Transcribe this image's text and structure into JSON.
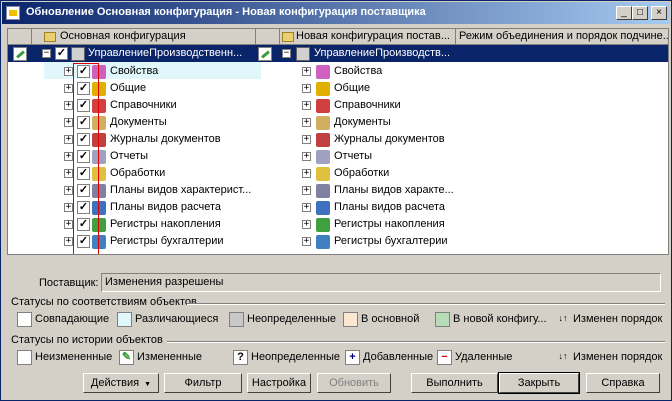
{
  "window": {
    "title": "Обновление Основная конфигурация - Новая конфигурация поставщика",
    "controls": [
      "_",
      "□",
      "×"
    ]
  },
  "grid": {
    "columns": {
      "main": "Основная конфигурация",
      "vendor": "Новая конфигурация постав...",
      "mode": "Режим объединения и порядок подчине..."
    },
    "root": {
      "main": "УправлениеПроизводственн...",
      "vendor": "УправлениеПроизводств..."
    },
    "rows": [
      {
        "main": "Свойства",
        "vendor": "Свойства",
        "icon": "properties-icon",
        "color": "#d060c0"
      },
      {
        "main": "Общие",
        "vendor": "Общие",
        "icon": "common-icon",
        "color": "#e0b000"
      },
      {
        "main": "Справочники",
        "vendor": "Справочники",
        "icon": "catalogs-icon",
        "color": "#d04040"
      },
      {
        "main": "Документы",
        "vendor": "Документы",
        "icon": "documents-icon",
        "color": "#d0b060"
      },
      {
        "main": "Журналы документов",
        "vendor": "Журналы документов",
        "icon": "journals-icon",
        "color": "#c04040"
      },
      {
        "main": "Отчеты",
        "vendor": "Отчеты",
        "icon": "reports-icon",
        "color": "#a0a0c0"
      },
      {
        "main": "Обработки",
        "vendor": "Обработки",
        "icon": "processing-icon",
        "color": "#e0c040"
      },
      {
        "main": "Планы видов характерист...",
        "vendor": "Планы видов характе...",
        "icon": "chart-types-icon",
        "color": "#8080a0"
      },
      {
        "main": "Планы видов расчета",
        "vendor": "Планы видов расчета",
        "icon": "calc-types-icon",
        "color": "#4070c0"
      },
      {
        "main": "Регистры накопления",
        "vendor": "Регистры накопления",
        "icon": "accum-registers-icon",
        "color": "#40a040"
      },
      {
        "main": "Регистры бухгалтерии",
        "vendor": "Регистры бухгалтерии",
        "icon": "account-registers-icon",
        "color": "#4080c0"
      }
    ]
  },
  "supplier": {
    "label": "Поставщик:",
    "value": "Изменения разрешены"
  },
  "legend_match": {
    "title": "Статусы по соответствиям объектов",
    "items": [
      {
        "label": "Совпадающие",
        "color": "#ffffff"
      },
      {
        "label": "Различающиеся",
        "color": "#e0f8fc"
      },
      {
        "label": "Неопределенные",
        "color": "#c8c8c8"
      },
      {
        "label": "В основной",
        "color": "#fce8d0"
      },
      {
        "label": "В новой конфигу...",
        "color": "#b8dcb8"
      },
      {
        "label": "Изменен порядок",
        "glyph": "↓↑"
      }
    ]
  },
  "legend_history": {
    "title": "Статусы по истории объектов",
    "items": [
      {
        "label": "Неизмененные",
        "glyph": ""
      },
      {
        "label": "Измененные",
        "glyph": "✎"
      },
      {
        "label": "Неопределенные",
        "glyph": "?"
      },
      {
        "label": "Добавленные",
        "glyph": "+"
      },
      {
        "label": "Удаленные",
        "glyph": "−"
      },
      {
        "label": "Изменен порядок",
        "glyph": "↓↑"
      }
    ]
  },
  "buttons": {
    "actions": "Действия",
    "filter": "Фильтр",
    "settings": "Настройка",
    "refresh": "Обновить",
    "execute": "Выполнить",
    "close": "Закрыть",
    "help": "Справка"
  }
}
